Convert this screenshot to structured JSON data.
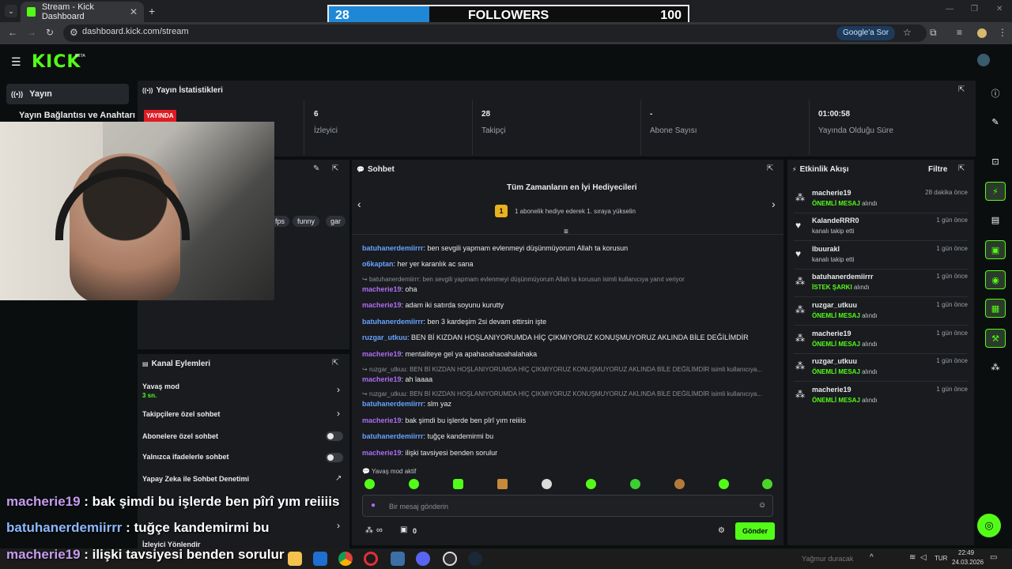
{
  "browser": {
    "tab_title": "Stream - Kick Dashboard",
    "url": "dashboard.kick.com/stream",
    "google_chip": "Google'a Sor"
  },
  "followers_goal": {
    "current": "28",
    "label": "FOLLOWERS",
    "target": "100",
    "progress": 0.28
  },
  "kick": {
    "logo": "KICK",
    "beta": "BETA"
  },
  "sidebar": {
    "active": "Yayın",
    "sub": "Yayın Bağlantısı ve Anahtarı"
  },
  "stats": {
    "title": "Yayın İstatistikleri",
    "live_badge": "YAYINDA",
    "items": [
      {
        "value": "6",
        "label": "İzleyici"
      },
      {
        "value": "28",
        "label": "Takipçi"
      },
      {
        "value": "-",
        "label": "Abone Sayısı"
      },
      {
        "value": "01:00:58",
        "label": "Yayında Olduğu Süre"
      }
    ]
  },
  "tags": [
    "fps",
    "funny",
    "gar"
  ],
  "chat": {
    "title": "Sohbet",
    "gifters_title": "Tüm Zamanların en İyi Hediyecileri",
    "gifter_rank": "1",
    "gifters_text": "1 abonelik hediye ederek 1. sıraya yükselin",
    "messages": [
      {
        "user": "batuhanerdemiirrr",
        "color": "blue",
        "text": ": ben sevgili yapmam evlenmeyi düşünmüyorum Allah ta korusun"
      },
      {
        "user": "o6kaptan",
        "color": "blue",
        "text": ": her yer karanlık ac sana"
      },
      {
        "reply": "batuhanerdemiirrr: ben sevgili yapmam evlenmeyi düşünmüyorum Allah ta korusun isimli kullanıcıya yanıt veriyor"
      },
      {
        "user": "macherie19",
        "color": "purple",
        "text": ": oha"
      },
      {
        "user": "macherie19",
        "color": "purple",
        "text": ": adam iki satırda soyunu kurutty"
      },
      {
        "user": "batuhanerdemiirrr",
        "color": "blue",
        "text": ": ben 3 kardeşim 2si devam ettirsin işte"
      },
      {
        "user": "ruzgar_utkuu",
        "color": "blue",
        "text": ": BEN Bİ KIZDAN HOŞLANIYORUMDA HİÇ ÇIKMIYORUZ KONUŞMUYORUZ AKLINDA BİLE DEĞİLİMDİR"
      },
      {
        "user": "macherie19",
        "color": "purple",
        "text": ": mentaliteye gel ya apahaoahaoahalahaka"
      },
      {
        "reply": "ruzgar_utkuu: BEN Bİ KIZDAN HOŞLANIYORUMDA HİÇ ÇIKMIYORUZ KONUŞMUYORUZ AKLINDA BİLE DEĞİLİMDİR isimli kullanıcıya..."
      },
      {
        "user": "macherie19",
        "color": "purple",
        "text": ": ah laaaa"
      },
      {
        "reply": "ruzgar_utkuu: BEN Bİ KIZDAN HOŞLANIYORUMDA HİÇ ÇIKMIYORUZ KONUŞMUYORUZ AKLINDA BİLE DEĞİLİMDİR isimli kullanıcıya..."
      },
      {
        "user": "batuhanerdemiirrr",
        "color": "blue",
        "text": ": slm yaz"
      },
      {
        "user": "macherie19",
        "color": "purple",
        "text": ": bak şimdi bu işlerde ben pîrî yım reiiiis"
      },
      {
        "user": "batuhanerdemiirrr",
        "color": "blue",
        "text": ": tuğçe kandemirmi bu"
      },
      {
        "user": "macherie19",
        "color": "purple",
        "text": ": ilişki tavsiyesi benden sorulur"
      }
    ],
    "slow_mode_note": "Yavaş mod aktif",
    "input_placeholder": "Bir mesaj gönderin",
    "points": "∞",
    "gift_count": "0",
    "send_label": "Gönder"
  },
  "events": {
    "title": "Etkinlik Akışı",
    "filter_label": "Filtre",
    "items": [
      {
        "icon": "sub",
        "name": "macherie19",
        "badge": "ÖNEMLİ MESAJ",
        "rest": " alındı",
        "time": "28 dakika önce"
      },
      {
        "icon": "heart",
        "name": "KalandeRRR0",
        "badge": "",
        "rest": "kanalı takip etti",
        "time": "1 gün önce"
      },
      {
        "icon": "heart",
        "name": "lbuurakl",
        "badge": "",
        "rest": "kanalı takip etti",
        "time": "1 gün önce"
      },
      {
        "icon": "sub",
        "name": "batuhanerdemiirrr",
        "badge": "İSTEK ŞARKI",
        "rest": " alındı",
        "time": "1 gün önce"
      },
      {
        "icon": "sub",
        "name": "ruzgar_utkuu",
        "badge": "ÖNEMLİ MESAJ",
        "rest": " alındı",
        "time": "1 gün önce"
      },
      {
        "icon": "sub",
        "name": "macherie19",
        "badge": "ÖNEMLİ MESAJ",
        "rest": " alındı",
        "time": "1 gün önce"
      },
      {
        "icon": "sub",
        "name": "ruzgar_utkuu",
        "badge": "ÖNEMLİ MESAJ",
        "rest": " alındı",
        "time": "1 gün önce"
      },
      {
        "icon": "sub",
        "name": "macherie19",
        "badge": "ÖNEMLİ MESAJ",
        "rest": " alındı",
        "time": "1 gün önce"
      }
    ]
  },
  "channel_actions": {
    "title": "Kanal Eylemleri",
    "slow_mode": "Yavaş mod",
    "slow_mode_value": "3 sn.",
    "followers_only": "Takipçilere özel sohbet",
    "subscribers_only": "Abonelere özel sohbet",
    "emotes_only": "Yalnızca ifadelerle sohbet",
    "ai_moderation": "Yapay Zeka ile Sohbet Denetimi",
    "viewer_direct": "İzleyici Yönlendir"
  },
  "captions": [
    {
      "user": "macherie19",
      "text": " : bak şimdi bu işlerde ben pîrî yım reiiiis"
    },
    {
      "user": "batuhanerdemiirrr",
      "text": " : tuğçe kandemirmi bu"
    },
    {
      "user": "macherie19",
      "text": " : ilişki tavsiyesi benden sorulur"
    }
  ],
  "taskbar": {
    "weather": "Yağmur duracak",
    "lang": "TUR",
    "time": "22:49",
    "date": "24.03.2026"
  }
}
